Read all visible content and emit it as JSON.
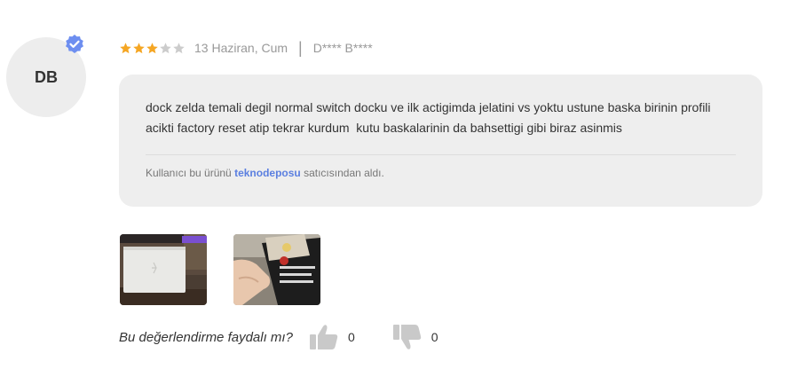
{
  "reviewer": {
    "initials": "DB",
    "name": "D**** B****",
    "verified_icon": "verified-badge-icon"
  },
  "review": {
    "rating": 3,
    "max_rating": 5,
    "date": "13 Haziran, Cum",
    "text": "dock zelda temali degil normal switch docku ve ilk actigimda jelatini vs yoktu ustune baska birinin profili acikti factory reset atip tekrar kurdum  kutu baskalarinin da bahsettigi gibi biraz asinmis",
    "seller_prefix": "Kullanıcı bu ürünü",
    "seller_name": "teknodeposu",
    "seller_suffix": "satıcısından aldı."
  },
  "photos": [
    {
      "name": "review-photo-dock"
    },
    {
      "name": "review-photo-box"
    }
  ],
  "helpful": {
    "question": "Bu değerlendirme faydalı mı?",
    "likes": "0",
    "dislikes": "0"
  },
  "colors": {
    "star_filled": "#f5a623",
    "star_empty": "#cccccc",
    "accent": "#5b7fe0",
    "bubble_bg": "#eeeeee"
  }
}
